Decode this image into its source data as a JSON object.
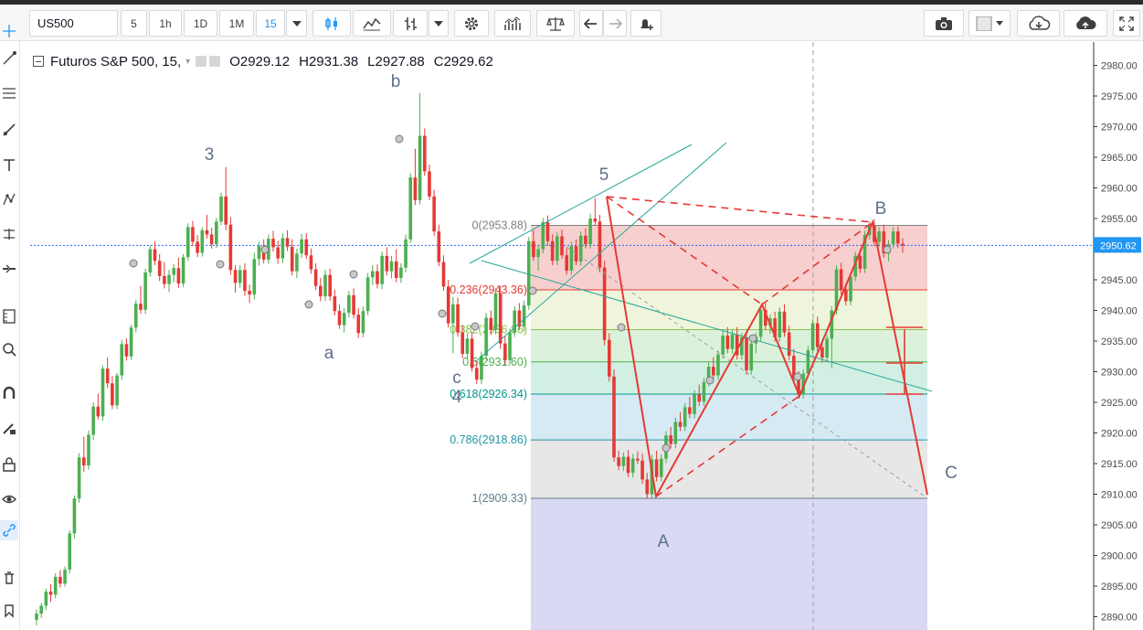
{
  "toolbar": {
    "symbol": "US500",
    "intervals": [
      "5",
      "1h",
      "1D",
      "1M",
      "15"
    ],
    "active_interval": "15"
  },
  "legend": {
    "title": "Futuros S&P 500, 15,",
    "open_label": "O",
    "open": "2929.12",
    "high_label": "H",
    "high": "2931.38",
    "low_label": "L",
    "low": "2927.88",
    "close_label": "C",
    "close": "2929.62"
  },
  "price_axis": {
    "ticks": [
      "2980.00",
      "2975.00",
      "2970.00",
      "2965.00",
      "2960.00",
      "2955.00",
      "2950.00",
      "2945.00",
      "2940.00",
      "2935.00",
      "2930.00",
      "2925.00",
      "2920.00",
      "2915.00",
      "2910.00",
      "2905.00",
      "2900.00",
      "2895.00",
      "2890.00"
    ],
    "current_price": "2950.62",
    "current_price_color": "#2196f3"
  },
  "wave_labels": {
    "w3": "3",
    "wb_small": "b",
    "wa_small": "a",
    "wc_small": "c",
    "w4": "4",
    "w5": "5",
    "wA": "A",
    "wB": "B",
    "wC": "C"
  },
  "fib_levels": [
    {
      "label": "0(2953.88)",
      "price": 2953.88,
      "color": "#808080"
    },
    {
      "label": "0.236(2943.36)",
      "price": 2943.36,
      "color": "#e53935"
    },
    {
      "label": "0.382(2936.86)",
      "price": 2936.86,
      "color": "#8bc34a"
    },
    {
      "label": "0.5(2931.60)",
      "price": 2931.6,
      "color": "#4caf50"
    },
    {
      "label": "0.618(2926.34)",
      "price": 2926.34,
      "color": "#009688"
    },
    {
      "label": "0.786(2918.86)",
      "price": 2918.86,
      "color": "#2196a3"
    },
    {
      "label": "1(2909.33)",
      "price": 2909.33,
      "color": "#607d8b"
    }
  ],
  "colors": {
    "up": "#4caf50",
    "down": "#e53935",
    "pattern": "#e53935",
    "channel": "#26a69a",
    "accent": "#2196f3"
  },
  "chart_data": {
    "type": "candlestick",
    "ylim": [
      2888,
      2983
    ],
    "candles": [
      [
        2889.5,
        2891.2,
        2888.6,
        2890.5
      ],
      [
        2890.5,
        2892.3,
        2889.8,
        2891.8
      ],
      [
        2891.8,
        2894.6,
        2891.1,
        2894.1
      ],
      [
        2894.1,
        2895.3,
        2892.4,
        2893.6
      ],
      [
        2893.6,
        2897.1,
        2893.0,
        2896.5
      ],
      [
        2896.5,
        2897.6,
        2894.8,
        2895.4
      ],
      [
        2895.4,
        2898.2,
        2894.9,
        2897.7
      ],
      [
        2897.7,
        2904.1,
        2897.1,
        2903.6
      ],
      [
        2903.6,
        2909.8,
        2902.8,
        2909.3
      ],
      [
        2909.3,
        2916.7,
        2908.6,
        2916.0
      ],
      [
        2916.0,
        2919.4,
        2913.6,
        2914.7
      ],
      [
        2914.7,
        2920.4,
        2914.0,
        2919.7
      ],
      [
        2919.7,
        2925.0,
        2918.9,
        2924.3
      ],
      [
        2924.3,
        2926.4,
        2922.2,
        2922.7
      ],
      [
        2922.7,
        2931.0,
        2922.0,
        2930.5
      ],
      [
        2930.5,
        2932.3,
        2927.3,
        2928.1
      ],
      [
        2928.1,
        2929.3,
        2923.9,
        2924.5
      ],
      [
        2924.5,
        2929.8,
        2923.9,
        2929.4
      ],
      [
        2929.4,
        2935.2,
        2928.7,
        2934.5
      ],
      [
        2934.5,
        2935.4,
        2931.8,
        2932.5
      ],
      [
        2932.5,
        2937.7,
        2931.9,
        2937.2
      ],
      [
        2937.2,
        2941.7,
        2936.4,
        2941.1
      ],
      [
        2941.1,
        2944.0,
        2939.5,
        2940.1
      ],
      [
        2940.1,
        2946.8,
        2939.4,
        2946.2
      ],
      [
        2946.2,
        2950.6,
        2945.5,
        2950.0
      ],
      [
        2950.0,
        2951.3,
        2947.4,
        2948.1
      ],
      [
        2948.1,
        2949.2,
        2944.8,
        2945.6
      ],
      [
        2945.6,
        2947.9,
        2943.6,
        2944.3
      ],
      [
        2944.3,
        2946.6,
        2943.0,
        2945.8
      ],
      [
        2945.8,
        2947.6,
        2944.6,
        2946.9
      ],
      [
        2946.9,
        2948.6,
        2943.7,
        2944.4
      ],
      [
        2944.4,
        2949.2,
        2943.8,
        2948.7
      ],
      [
        2948.7,
        2954.2,
        2948.1,
        2953.6
      ],
      [
        2953.6,
        2954.6,
        2950.5,
        2951.2
      ],
      [
        2951.2,
        2952.3,
        2948.7,
        2949.4
      ],
      [
        2949.4,
        2953.6,
        2948.8,
        2953.1
      ],
      [
        2953.1,
        2955.6,
        2951.7,
        2952.4
      ],
      [
        2952.4,
        2953.5,
        2950.1,
        2950.8
      ],
      [
        2950.8,
        2955.1,
        2950.2,
        2954.5
      ],
      [
        2954.5,
        2959.2,
        2953.9,
        2958.6
      ],
      [
        2958.6,
        2963.4,
        2953.1,
        2954.0
      ],
      [
        2954.0,
        2955.2,
        2945.8,
        2946.6
      ],
      [
        2946.6,
        2947.4,
        2942.9,
        2944.5
      ],
      [
        2944.5,
        2947.4,
        2943.7,
        2946.6
      ],
      [
        2946.6,
        2947.7,
        2942.4,
        2943.2
      ],
      [
        2943.2,
        2944.2,
        2941.2,
        2942.6
      ],
      [
        2942.6,
        2949.4,
        2941.8,
        2948.4
      ],
      [
        2948.4,
        2951.2,
        2947.3,
        2950.5
      ],
      [
        2950.5,
        2951.6,
        2947.7,
        2948.3
      ],
      [
        2948.3,
        2952.4,
        2947.6,
        2951.7
      ],
      [
        2951.7,
        2953.0,
        2949.6,
        2950.3
      ],
      [
        2950.3,
        2951.4,
        2947.6,
        2948.5
      ],
      [
        2948.5,
        2952.6,
        2947.7,
        2951.8
      ],
      [
        2951.8,
        2953.1,
        2949.7,
        2950.4
      ],
      [
        2950.4,
        2951.6,
        2945.7,
        2946.4
      ],
      [
        2946.4,
        2950.1,
        2945.3,
        2949.3
      ],
      [
        2949.3,
        2952.5,
        2948.6,
        2951.6
      ],
      [
        2951.6,
        2952.6,
        2948.4,
        2949.0
      ],
      [
        2949.0,
        2950.1,
        2946.0,
        2946.7
      ],
      [
        2946.7,
        2947.7,
        2943.3,
        2944.0
      ],
      [
        2944.0,
        2945.3,
        2941.5,
        2942.3
      ],
      [
        2942.3,
        2946.6,
        2941.6,
        2945.8
      ],
      [
        2945.8,
        2946.8,
        2941.6,
        2942.3
      ],
      [
        2942.3,
        2943.4,
        2939.2,
        2939.9
      ],
      [
        2939.9,
        2941.0,
        2937.0,
        2937.6
      ],
      [
        2937.6,
        2940.4,
        2936.4,
        2939.6
      ],
      [
        2939.6,
        2943.2,
        2938.9,
        2942.5
      ],
      [
        2942.5,
        2943.6,
        2938.7,
        2939.3
      ],
      [
        2939.3,
        2940.4,
        2935.5,
        2936.3
      ],
      [
        2936.3,
        2940.6,
        2935.6,
        2939.9
      ],
      [
        2939.9,
        2946.1,
        2939.2,
        2945.4
      ],
      [
        2945.4,
        2947.4,
        2944.1,
        2946.4
      ],
      [
        2946.4,
        2947.5,
        2943.6,
        2944.3
      ],
      [
        2944.3,
        2949.6,
        2943.5,
        2948.9
      ],
      [
        2948.9,
        2950.3,
        2945.7,
        2946.4
      ],
      [
        2946.4,
        2948.9,
        2945.2,
        2948.0
      ],
      [
        2948.0,
        2950.0,
        2944.6,
        2945.3
      ],
      [
        2945.3,
        2947.7,
        2944.5,
        2947.0
      ],
      [
        2947.0,
        2952.4,
        2946.2,
        2951.6
      ],
      [
        2951.6,
        2962.4,
        2951.0,
        2961.7
      ],
      [
        2961.7,
        2966.4,
        2957.2,
        2958.0
      ],
      [
        2958.0,
        2975.5,
        2957.3,
        2968.5
      ],
      [
        2968.5,
        2969.7,
        2962.0,
        2962.7
      ],
      [
        2962.7,
        2963.8,
        2958.0,
        2958.6
      ],
      [
        2958.6,
        2959.7,
        2952.2,
        2952.9
      ],
      [
        2952.9,
        2954.0,
        2947.2,
        2947.9
      ],
      [
        2947.9,
        2949.0,
        2943.2,
        2943.9
      ],
      [
        2943.9,
        2945.0,
        2937.2,
        2937.9
      ],
      [
        2937.9,
        2942.2,
        2933.0,
        2941.0
      ],
      [
        2941.0,
        2942.1,
        2935.7,
        2936.4
      ],
      [
        2936.4,
        2937.5,
        2932.2,
        2932.9
      ],
      [
        2932.9,
        2936.2,
        2932.2,
        2935.4
      ],
      [
        2935.4,
        2936.5,
        2930.0,
        2930.6
      ],
      [
        2930.6,
        2931.7,
        2928.0,
        2928.7
      ],
      [
        2928.7,
        2933.3,
        2928.0,
        2932.6
      ],
      [
        2932.6,
        2939.6,
        2931.8,
        2938.8
      ],
      [
        2938.8,
        2940.0,
        2936.0,
        2936.8
      ],
      [
        2936.8,
        2943.6,
        2936.1,
        2942.8
      ],
      [
        2942.8,
        2944.0,
        2933.7,
        2934.6
      ],
      [
        2934.6,
        2935.8,
        2931.1,
        2931.9
      ],
      [
        2931.9,
        2937.1,
        2931.2,
        2936.4
      ],
      [
        2936.4,
        2940.7,
        2935.7,
        2940.0
      ],
      [
        2940.0,
        2941.2,
        2936.8,
        2937.4
      ],
      [
        2937.4,
        2941.6,
        2936.6,
        2940.8
      ],
      [
        2940.8,
        2952.0,
        2940.1,
        2951.3
      ],
      [
        2951.3,
        2953.1,
        2948.1,
        2948.7
      ],
      [
        2948.7,
        2950.6,
        2946.5,
        2950.0
      ],
      [
        2950.0,
        2955.1,
        2949.3,
        2954.4
      ],
      [
        2954.4,
        2955.5,
        2950.6,
        2951.3
      ],
      [
        2951.3,
        2952.4,
        2947.4,
        2948.1
      ],
      [
        2948.1,
        2952.8,
        2947.4,
        2952.1
      ],
      [
        2952.1,
        2953.2,
        2948.4,
        2949.0
      ],
      [
        2949.0,
        2950.2,
        2945.8,
        2946.5
      ],
      [
        2946.5,
        2951.2,
        2945.8,
        2950.5
      ],
      [
        2950.5,
        2951.6,
        2947.4,
        2948.0
      ],
      [
        2948.0,
        2952.9,
        2947.3,
        2952.2
      ],
      [
        2952.2,
        2953.4,
        2950.1,
        2950.8
      ],
      [
        2950.8,
        2955.8,
        2950.1,
        2955.0
      ],
      [
        2955.0,
        2958.3,
        2953.9,
        2954.5
      ],
      [
        2954.5,
        2955.6,
        2946.2,
        2947.0
      ],
      [
        2947.0,
        2948.1,
        2934.3,
        2935.2
      ],
      [
        2935.2,
        2936.3,
        2928.4,
        2929.2
      ],
      [
        2929.2,
        2930.4,
        2915.3,
        2916.0
      ],
      [
        2916.0,
        2917.1,
        2913.9,
        2914.6
      ],
      [
        2914.6,
        2916.8,
        2913.8,
        2916.1
      ],
      [
        2916.1,
        2917.2,
        2912.8,
        2913.5
      ],
      [
        2913.5,
        2916.6,
        2912.7,
        2915.8
      ],
      [
        2915.8,
        2917.0,
        2914.9,
        2915.5
      ],
      [
        2915.5,
        2916.6,
        2911.7,
        2912.4
      ],
      [
        2912.4,
        2913.5,
        2909.3,
        2910.0
      ],
      [
        2910.0,
        2916.4,
        2909.4,
        2915.7
      ],
      [
        2915.7,
        2917.1,
        2912.1,
        2912.8
      ],
      [
        2912.8,
        2916.5,
        2912.1,
        2915.8
      ],
      [
        2915.8,
        2920.3,
        2915.1,
        2919.6
      ],
      [
        2919.6,
        2921.0,
        2917.5,
        2918.2
      ],
      [
        2918.2,
        2922.5,
        2917.5,
        2921.8
      ],
      [
        2921.8,
        2923.4,
        2920.3,
        2921.0
      ],
      [
        2921.0,
        2924.9,
        2920.3,
        2924.2
      ],
      [
        2924.2,
        2925.9,
        2922.4,
        2923.1
      ],
      [
        2923.1,
        2927.0,
        2922.4,
        2926.3
      ],
      [
        2926.3,
        2927.9,
        2924.4,
        2925.1
      ],
      [
        2925.1,
        2929.0,
        2924.4,
        2928.3
      ],
      [
        2928.3,
        2931.5,
        2927.6,
        2930.8
      ],
      [
        2930.8,
        2932.4,
        2928.7,
        2929.4
      ],
      [
        2929.4,
        2933.5,
        2928.7,
        2932.8
      ],
      [
        2932.8,
        2936.6,
        2932.1,
        2935.9
      ],
      [
        2935.9,
        2937.3,
        2933.0,
        2933.7
      ],
      [
        2933.7,
        2936.8,
        2933.0,
        2936.1
      ],
      [
        2936.1,
        2937.3,
        2932.0,
        2932.7
      ],
      [
        2932.7,
        2936.3,
        2932.0,
        2935.6
      ],
      [
        2935.6,
        2936.7,
        2929.5,
        2930.2
      ],
      [
        2930.2,
        2935.3,
        2929.5,
        2934.6
      ],
      [
        2934.6,
        2936.4,
        2933.0,
        2935.7
      ],
      [
        2935.7,
        2940.8,
        2935.0,
        2940.1
      ],
      [
        2940.1,
        2941.2,
        2936.8,
        2937.5
      ],
      [
        2937.5,
        2939.4,
        2936.2,
        2938.7
      ],
      [
        2938.7,
        2939.8,
        2934.9,
        2935.6
      ],
      [
        2935.6,
        2940.5,
        2934.9,
        2939.8
      ],
      [
        2939.8,
        2941.0,
        2935.7,
        2936.4
      ],
      [
        2936.4,
        2937.5,
        2931.9,
        2932.6
      ],
      [
        2932.6,
        2933.7,
        2928.3,
        2929.0
      ],
      [
        2929.0,
        2930.1,
        2925.6,
        2926.3
      ],
      [
        2926.3,
        2930.4,
        2925.6,
        2929.7
      ],
      [
        2929.7,
        2934.2,
        2929.0,
        2933.5
      ],
      [
        2933.5,
        2938.6,
        2932.8,
        2937.9
      ],
      [
        2937.9,
        2939.0,
        2933.3,
        2934.0
      ],
      [
        2934.0,
        2935.1,
        2931.6,
        2932.3
      ],
      [
        2932.3,
        2936.1,
        2931.6,
        2935.4
      ],
      [
        2935.4,
        2940.7,
        2930.6,
        2940.0
      ],
      [
        2940.0,
        2947.4,
        2939.3,
        2946.7
      ],
      [
        2946.7,
        2947.8,
        2942.6,
        2943.3
      ],
      [
        2943.3,
        2944.4,
        2940.8,
        2941.5
      ],
      [
        2941.5,
        2946.2,
        2940.8,
        2945.5
      ],
      [
        2945.5,
        2949.6,
        2944.8,
        2948.9
      ],
      [
        2948.9,
        2950.0,
        2946.1,
        2946.8
      ],
      [
        2946.8,
        2953.0,
        2946.1,
        2952.3
      ],
      [
        2952.3,
        2954.5,
        2951.6,
        2953.8
      ],
      [
        2953.8,
        2954.9,
        2950.5,
        2951.2
      ],
      [
        2951.2,
        2953.6,
        2950.4,
        2952.9
      ],
      [
        2952.9,
        2954.0,
        2948.6,
        2949.3
      ],
      [
        2949.3,
        2951.5,
        2948.0,
        2950.8
      ],
      [
        2950.8,
        2953.6,
        2950.1,
        2952.9
      ],
      [
        2952.9,
        2953.7,
        2950.2,
        2950.9
      ],
      [
        2950.9,
        2951.8,
        2949.4,
        2950.6
      ]
    ]
  }
}
